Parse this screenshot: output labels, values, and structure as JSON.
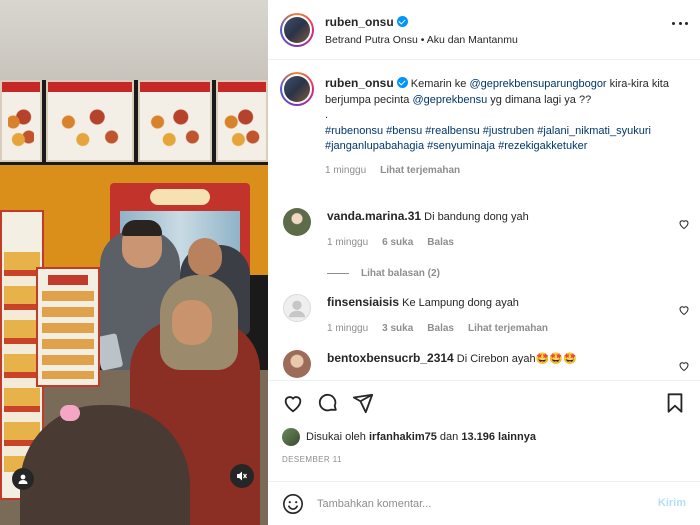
{
  "post": {
    "username": "ruben_onsu",
    "audio": "Betrand Putra Onsu • Aku dan Mantanmu",
    "caption_line1_pre": "Kemarin ke ",
    "caption_mention1": "@geprekbensuparungbogor",
    "caption_line1_post": " kira-kira kita berjumpa pecinta ",
    "caption_mention2": "@geprekbensu",
    "caption_line1_end": " yg dimana lagi ya ??",
    "caption_dot": ".",
    "hashtags": "#rubenonsu #bensu #realbensu #justruben #jalani_nikmati_syukuri #janganlupabahagia #senyuminaja #rezekigakketuker",
    "caption_time": "1 minggu",
    "see_translation": "Lihat terjemahan"
  },
  "comments": [
    {
      "username": "vanda.marina.31",
      "text": "Di bandung dong yah",
      "time": "1 minggu",
      "likes": "6 suka",
      "reply": "Balas",
      "view_replies": "Lihat balasan (2)",
      "avatar_color": "#5d6b4a"
    },
    {
      "username": "finsensiaisis",
      "text": "Ke Lampung dong ayah",
      "time": "1 minggu",
      "likes": "3 suka",
      "reply": "Balas",
      "translate": "Lihat terjemahan",
      "avatar_color": "#dbdbdb"
    },
    {
      "username": "bentoxbensucrb_2314",
      "text": "Di Cirebon ayah🤩🤩🤩",
      "avatar_color": "#9c6b5a"
    }
  ],
  "engagement": {
    "liked_by_prefix": "Disukai oleh ",
    "liked_by_user": "irfanhakim75",
    "liked_by_middle": " dan ",
    "liked_by_count": "13.196 lainnya",
    "date": "DESEMBER 11"
  },
  "composer": {
    "placeholder": "Tambahkan komentar...",
    "post_label": "Kirim"
  },
  "icons": {
    "verified": "verified-badge-icon",
    "like": "heart-icon",
    "comment": "comment-icon",
    "share": "send-icon",
    "save": "bookmark-icon",
    "emoji": "smiley-icon",
    "mute": "speaker-muted-icon"
  },
  "colors": {
    "accent": "#0095f6",
    "link": "#00376b",
    "muted": "#8e8e8e"
  }
}
